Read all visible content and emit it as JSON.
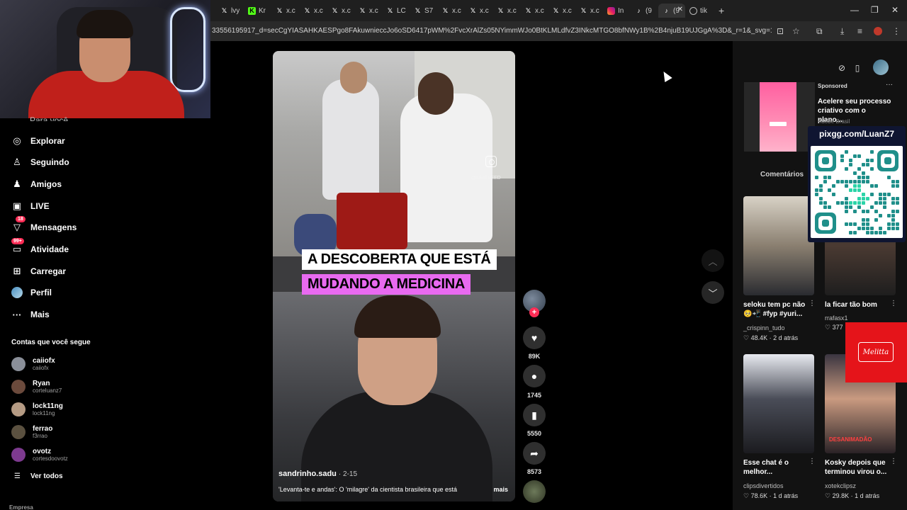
{
  "browser": {
    "tabs": [
      {
        "icon": "x",
        "label": "lvy"
      },
      {
        "icon": "k",
        "label": "Kr"
      },
      {
        "icon": "x",
        "label": "x.c"
      },
      {
        "icon": "x",
        "label": "x.c"
      },
      {
        "icon": "x",
        "label": "x.c"
      },
      {
        "icon": "x",
        "label": "x.c"
      },
      {
        "icon": "x",
        "label": "LC"
      },
      {
        "icon": "x",
        "label": "S7"
      },
      {
        "icon": "x",
        "label": "x.c"
      },
      {
        "icon": "x",
        "label": "x.c"
      },
      {
        "icon": "x",
        "label": "x.c"
      },
      {
        "icon": "x",
        "label": "x.c"
      },
      {
        "icon": "x",
        "label": "x.c"
      },
      {
        "icon": "x",
        "label": "x.c"
      },
      {
        "icon": "ig",
        "label": "In"
      },
      {
        "icon": "tt",
        "label": "(9"
      },
      {
        "icon": "tt",
        "label": "(9"
      },
      {
        "icon": "globe",
        "label": "tik"
      }
    ],
    "url": "33556195917_d=secCgYIASAHKAESPgo8FAkuwnieccJo6oSD6417pWM%2FvcXrAlZs05NYimmWJo0BtKLMLdfvZ3INkcMTGO8bfNWy1B%2B4njuB19UJGgA%3D&_r=1&_svg=1&checksum=ceb3..."
  },
  "sidebar": {
    "cut_top": "Para você",
    "nav": [
      {
        "icon": "compass-icon",
        "glyph": "◎",
        "label": "Explorar"
      },
      {
        "icon": "following-icon",
        "glyph": "♙",
        "label": "Seguindo"
      },
      {
        "icon": "friends-icon",
        "glyph": "♟",
        "label": "Amigos"
      },
      {
        "icon": "live-icon",
        "glyph": "▣",
        "label": "LIVE"
      },
      {
        "icon": "messages-icon",
        "glyph": "▽",
        "label": "Mensagens",
        "badge": "18"
      },
      {
        "icon": "activity-icon",
        "glyph": "▭",
        "label": "Atividade",
        "badge": "99+"
      },
      {
        "icon": "upload-icon",
        "glyph": "⊞",
        "label": "Carregar"
      },
      {
        "icon": "profile-icon",
        "glyph": "",
        "label": "Perfil"
      },
      {
        "icon": "more-icon",
        "glyph": "···",
        "label": "Mais"
      }
    ],
    "following_header": "Contas que você segue",
    "following": [
      {
        "name": "caiiofx",
        "user": "caiiofx",
        "color": "#8a8f99"
      },
      {
        "name": "Ryan",
        "user": "corteluanz7",
        "color": "#6b4a3c"
      },
      {
        "name": "lock11ng",
        "user": "lock11ng",
        "color": "#b59b84"
      },
      {
        "name": "ferrao",
        "user": "f3rrao",
        "color": "#5b5140"
      },
      {
        "name": "ovotz",
        "user": "cortesdoovotz",
        "color": "#7d3a8f"
      }
    ],
    "see_all": "Ver todos",
    "footer_cut": "Empresa"
  },
  "video": {
    "caption_line1": "A DESCOBERTA QUE ESTÁ",
    "caption_line2": "MUDANDO A MEDICINA",
    "watermark": "@OFITFEED",
    "author": "sandrinho.sadu",
    "date": "· 2-15",
    "description": "'Levanta-te e andas': O 'milagre' da cientista brasileira que está",
    "more": "mais"
  },
  "actions": {
    "follow_plus": "+",
    "likes": "89K",
    "comments": "1745",
    "saves": "5550",
    "shares": "8573"
  },
  "right_panel": {
    "ad": {
      "sponsored": "Sponsored",
      "title": "Acelere seu processo criativo com o plano...",
      "brand": "Adobe Brasil"
    },
    "comments_tab": "Comentários",
    "qr_title": "pixgg.com/LuanZ7",
    "videos": [
      {
        "title": "seloku tem pc não 🥺📲 #fyp #yuri...",
        "user": "_crispinn_tudo",
        "likes": "48.4K",
        "ago": "2 d atrás"
      },
      {
        "title": "la ficar tão bom",
        "user": "rrafasx1",
        "likes": "377",
        "ago": ""
      },
      {
        "title": "Esse chat é o melhor...",
        "user": "clipsdivertidos",
        "likes": "78.6K",
        "ago": "1 d atrás"
      },
      {
        "title": "Kosky depois que terminou virou o...",
        "user": "xotekclipsz",
        "likes": "29.8K",
        "ago": "1 d atrás"
      }
    ],
    "thumb_caption": "DESANIMADÃO",
    "melitta": "Melitta"
  },
  "colors": {
    "accent": "#fe2c55",
    "caption_pink": "#e86af0",
    "qr_bg": "#0f1531",
    "melitta_red": "#e5141a"
  }
}
